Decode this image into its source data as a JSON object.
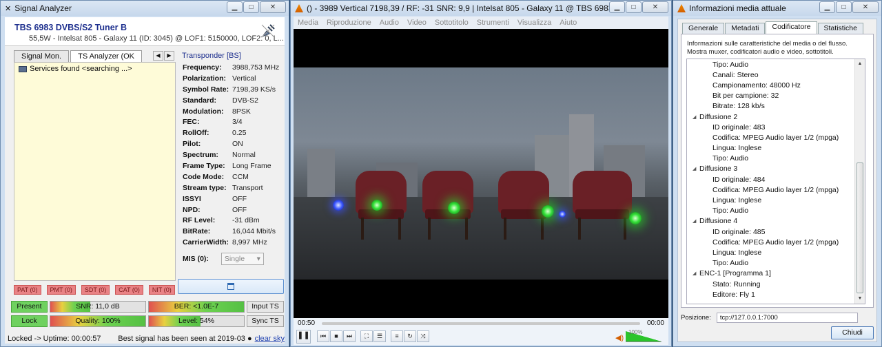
{
  "signal_analyzer": {
    "title": "Signal Analyzer",
    "tuner_name": "TBS 6983 DVBS/S2 Tuner B",
    "tuner_info": "55,5W - Intelsat 805 - Galaxy 11 (ID: 3045) @ LOF1: 5150000, LOF2: 0, L...",
    "tabs": [
      "Signal Mon.",
      "TS Analyzer (OK"
    ],
    "tree_item": "Services found <searching ...>",
    "transponder_header": "Transponder [BS]",
    "params": [
      {
        "label": "Frequency:",
        "value": "3988,753 MHz"
      },
      {
        "label": "Polarization:",
        "value": "Vertical"
      },
      {
        "label": "Symbol Rate:",
        "value": "7198,39 KS/s"
      },
      {
        "label": "Standard:",
        "value": "DVB-S2"
      },
      {
        "label": "Modulation:",
        "value": "8PSK"
      },
      {
        "label": "FEC:",
        "value": "3/4"
      },
      {
        "label": "RollOff:",
        "value": "0.25"
      },
      {
        "label": "Pilot:",
        "value": "ON"
      },
      {
        "label": "Spectrum:",
        "value": "Normal"
      },
      {
        "label": "Frame Type:",
        "value": "Long Frame"
      },
      {
        "label": "Code Mode:",
        "value": "CCM"
      },
      {
        "label": "Stream type:",
        "value": "Transport"
      },
      {
        "label": "ISSYI",
        "value": "OFF"
      },
      {
        "label": "NPD:",
        "value": "OFF"
      },
      {
        "label": "RF Level:",
        "value": "-31 dBm"
      },
      {
        "label": "BitRate:",
        "value": "16,044 Mbit/s"
      },
      {
        "label": "CarrierWidth:",
        "value": "8,997 MHz"
      }
    ],
    "mis_label": "MIS (0):",
    "mis_value": "Single",
    "flags": [
      "PAT (0)",
      "PMT (0)",
      "SDT (0)",
      "CAT (0)",
      "NIT (0)"
    ],
    "meters": {
      "present": "Present",
      "snr": "SNR: 11,0 dB",
      "snr_fill": 0.42,
      "ber": "BER: <1.0E-7",
      "ber_fill": 1.0,
      "input_ts": "Input TS",
      "lock": "Lock",
      "quality": "Quality: 100%",
      "quality_fill": 1.0,
      "level": "Level: 54%",
      "level_fill": 0.54,
      "sync_ts": "Sync TS"
    },
    "status_text": "Locked -> Uptime: 00:00:57",
    "best_signal": "Best signal has been seen at 2019-03",
    "clear_sky": "clear sky"
  },
  "vlc": {
    "title": "() - 3989 Vertical 7198,39 / RF: -31 SNR: 9,9 | Intelsat 805 - Galaxy 11 @ TBS 6983 DVBS/S2 Tuner...",
    "menu": [
      "Media",
      "Riproduzione",
      "Audio",
      "Video",
      "Sottotitolo",
      "Strumenti",
      "Visualizza",
      "Aiuto"
    ],
    "time_elapsed": "00:50",
    "time_total": "00:00",
    "volume": "100%",
    "volume_level": 1.0
  },
  "media_info": {
    "title": "Informazioni media attuale",
    "tabs": [
      "Generale",
      "Metadati",
      "Codificatore",
      "Statistiche"
    ],
    "active_tab": "Codificatore",
    "description": "Informazioni sulle caratteristiche del media o del flusso. Mostra muxer, codificatori audio e video, sottotitoli.",
    "tree": [
      {
        "level": 2,
        "text": "Tipo: Audio"
      },
      {
        "level": 2,
        "text": "Canali: Stereo"
      },
      {
        "level": 2,
        "text": "Campionamento: 48000 Hz"
      },
      {
        "level": 2,
        "text": "Bit per campione: 32"
      },
      {
        "level": 2,
        "text": "Bitrate: 128 kb/s"
      },
      {
        "level": 1,
        "text": "Diffusione 2"
      },
      {
        "level": 2,
        "text": "ID originale: 483"
      },
      {
        "level": 2,
        "text": "Codifica: MPEG Audio layer 1/2 (mpga)"
      },
      {
        "level": 2,
        "text": "Lingua: Inglese"
      },
      {
        "level": 2,
        "text": "Tipo: Audio"
      },
      {
        "level": 1,
        "text": "Diffusione 3"
      },
      {
        "level": 2,
        "text": "ID originale: 484"
      },
      {
        "level": 2,
        "text": "Codifica: MPEG Audio layer 1/2 (mpga)"
      },
      {
        "level": 2,
        "text": "Lingua: Inglese"
      },
      {
        "level": 2,
        "text": "Tipo: Audio"
      },
      {
        "level": 1,
        "text": "Diffusione 4"
      },
      {
        "level": 2,
        "text": "ID originale: 485"
      },
      {
        "level": 2,
        "text": "Codifica: MPEG Audio layer 1/2 (mpga)"
      },
      {
        "level": 2,
        "text": "Lingua: Inglese"
      },
      {
        "level": 2,
        "text": "Tipo: Audio"
      },
      {
        "level": 1,
        "text": "ENC-1 [Programma 1]"
      },
      {
        "level": 2,
        "text": "Stato: Running"
      },
      {
        "level": 2,
        "text": "Editore: Fly 1"
      }
    ],
    "position_label": "Posizione:",
    "position_value": "tcp://127.0.0.1:7000",
    "close_button": "Chiudi"
  }
}
